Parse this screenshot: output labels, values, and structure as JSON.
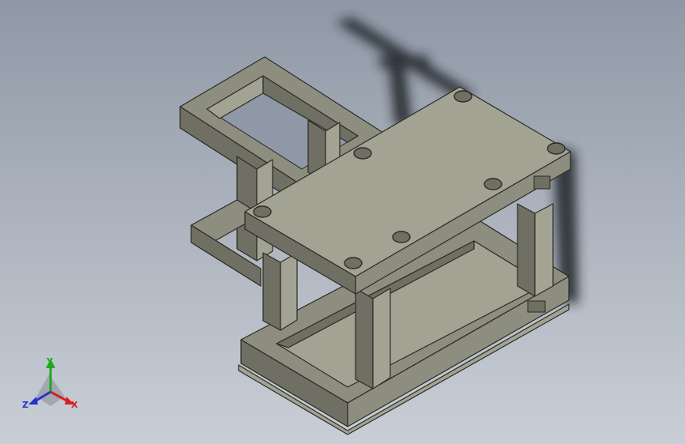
{
  "viewport": {
    "background_top": "#8f98a6",
    "background_bottom": "#c9ced6"
  },
  "model": {
    "face_color": "#8e8e80",
    "face_dark": "#6f6f63",
    "face_light": "#a3a394",
    "edge_color": "#2b2b25",
    "shadow_color": "#1f2226"
  },
  "triad": {
    "x_label": "X",
    "y_label": "Y",
    "z_label": "Z",
    "x_color": "#d42020",
    "y_color": "#1fa81f",
    "z_color": "#2233cc"
  }
}
